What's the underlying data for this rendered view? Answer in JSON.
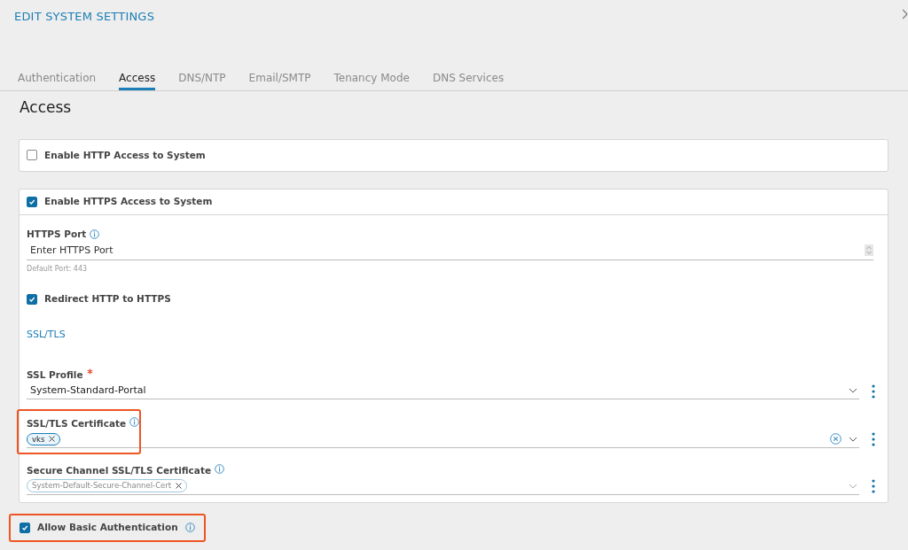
{
  "dialog": {
    "title": "EDIT SYSTEM SETTINGS"
  },
  "tabs": [
    {
      "label": "Authentication",
      "selected": false
    },
    {
      "label": "Access",
      "selected": true
    },
    {
      "label": "DNS/NTP",
      "selected": false
    },
    {
      "label": "Email/SMTP",
      "selected": false
    },
    {
      "label": "Tenancy Mode",
      "selected": false
    },
    {
      "label": "DNS Services",
      "selected": false
    }
  ],
  "section_title": "Access",
  "http_panel": {
    "label": "Enable HTTP Access to System",
    "checked": false
  },
  "https_panel": {
    "label": "Enable HTTPS Access to System",
    "checked": true,
    "port": {
      "label": "HTTPS Port",
      "placeholder": "Enter HTTPS Port",
      "hint": "Default Port: 443"
    },
    "redirect": {
      "label": "Redirect HTTP to HTTPS",
      "checked": true
    },
    "subsection": "SSL/TLS",
    "fields": [
      {
        "kind": "select",
        "label": "SSL Profile",
        "required": true,
        "info": false,
        "value": "System-Standard-Portal",
        "disabled": false,
        "highlighted": false
      },
      {
        "kind": "multiselect",
        "label": "SSL/TLS Certificate",
        "required": false,
        "info": true,
        "tags": [
          "vks"
        ],
        "clearable": true,
        "disabled": false,
        "highlighted": true
      },
      {
        "kind": "multiselect",
        "label": "Secure Channel SSL/TLS Certificate",
        "required": false,
        "info": true,
        "tags": [
          "System-Default-Secure-Channel-Cert"
        ],
        "clearable": false,
        "disabled": true,
        "highlighted": false
      }
    ]
  },
  "basic_auth": {
    "label": "Allow Basic Authentication",
    "checked": true,
    "info": true,
    "highlighted": true
  }
}
